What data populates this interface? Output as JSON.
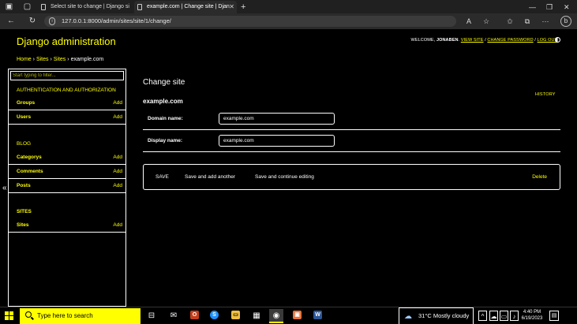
{
  "browser": {
    "tabs": [
      {
        "title": "Select site to change | Django si"
      },
      {
        "title": "example.com | Change site | Djan"
      }
    ],
    "url": "127.0.0.1:8000/admin/sites/site/1/change/"
  },
  "header": {
    "branding": "Django administration",
    "welcome": "WELCOME,",
    "username": "JONABEN",
    "view_site": "VIEW SITE",
    "change_password": "CHANGE PASSWORD",
    "log_out": "LOG OUT"
  },
  "breadcrumbs": {
    "home": "Home",
    "app": "Sites",
    "model": "Sites",
    "current": "example.com",
    "sep": "›"
  },
  "sidebar": {
    "filter_placeholder": "Start typing to filter...",
    "apps": [
      {
        "caption": "AUTHENTICATION AND AUTHORIZATION",
        "models": [
          {
            "name": "Groups",
            "add": "Add"
          },
          {
            "name": "Users",
            "add": "Add"
          }
        ]
      },
      {
        "caption": "BLOG",
        "models": [
          {
            "name": "Categorys",
            "add": "Add"
          },
          {
            "name": "Comments",
            "add": "Add"
          },
          {
            "name": "Posts",
            "add": "Add"
          }
        ]
      },
      {
        "caption": "SITES",
        "models": [
          {
            "name": "Sites",
            "add": "Add"
          }
        ]
      }
    ],
    "collapse": "«"
  },
  "content": {
    "title": "Change site",
    "history": "HISTORY",
    "object_name": "example.com",
    "fields": [
      {
        "label": "Domain name:",
        "value": "example.com"
      },
      {
        "label": "Display name:",
        "value": "example.com"
      }
    ],
    "buttons": {
      "save": "SAVE",
      "save_add": "Save and add another",
      "save_continue": "Save and continue editing",
      "delete": "Delete"
    }
  },
  "taskbar": {
    "search_placeholder": "Type here to search",
    "weather": "31°C  Mostly cloudy",
    "time": "4:40 PM",
    "date": "6/19/2023"
  },
  "colors": {
    "accent": "#ffff00",
    "background": "#000000"
  }
}
